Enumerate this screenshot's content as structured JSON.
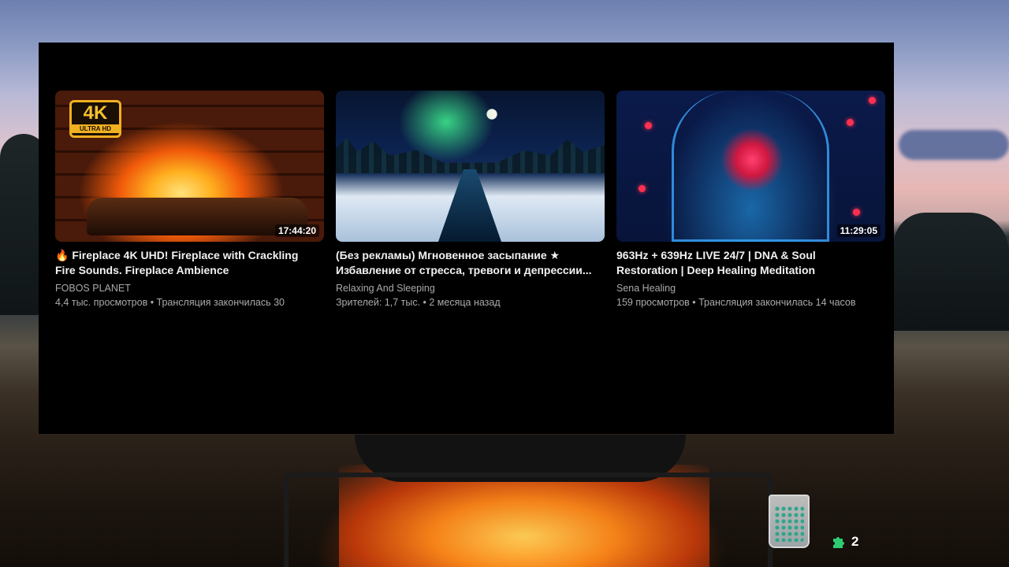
{
  "videos": [
    {
      "title_line1": "🔥 Fireplace 4K UHD! Fireplace with Crackling",
      "title_line2": "Fire Sounds. Fireplace Ambience",
      "channel": "FOBOS PLANET",
      "meta": "4,4 тыс. просмотров • Трансляция закончилась 30",
      "duration": "17:44:20",
      "badge_big": "4K",
      "badge_small": "ULTRA HD"
    },
    {
      "title_line1": "(Без рекламы) Мгновенное засыпание ★",
      "title_line2": "Избавление от стресса, тревоги и депрессии...",
      "channel": "Relaxing And Sleeping",
      "meta": "Зрителей: 1,7 тыс. • 2 месяца назад"
    },
    {
      "title_line1": "963Hz + 639Hz LIVE 24/7 | DNA & Soul",
      "title_line2": "Restoration | Deep Healing Meditation",
      "channel": "Sena Healing",
      "meta": "159 просмотров • Трансляция закончилась 14 часов",
      "duration": "11:29:05"
    }
  ],
  "tray": {
    "notification_count": "2",
    "notification_icon": "puzzle-icon",
    "glass_icon": "recycle-bin-icon"
  },
  "colors": {
    "window_bg": "#000000",
    "title_text": "#f1f1f1",
    "secondary_text": "#aaaaaa",
    "tray_icon": "#2ecc71"
  }
}
